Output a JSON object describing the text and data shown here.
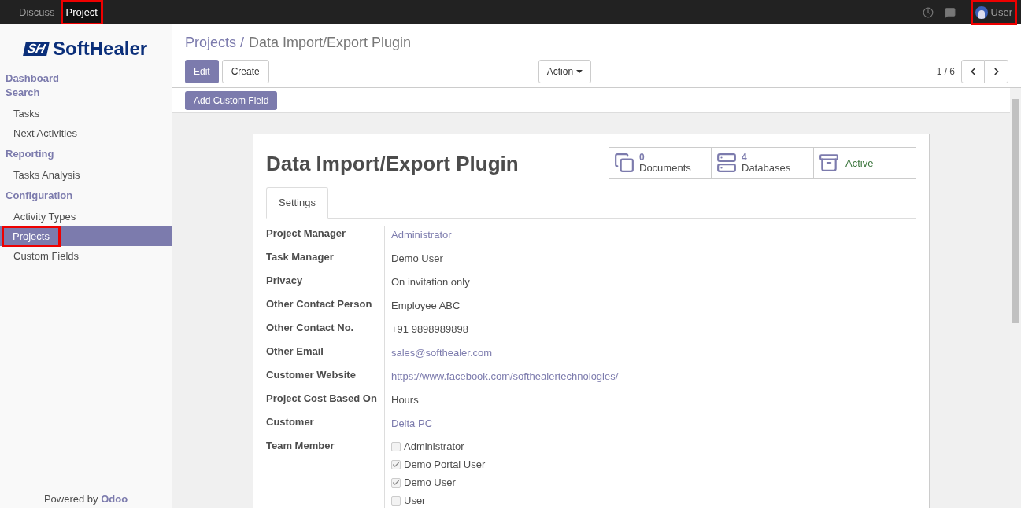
{
  "topbar": {
    "apps": [
      {
        "label": "Discuss",
        "selected": false,
        "highlighted": false
      },
      {
        "label": "Project",
        "selected": true,
        "highlighted": true
      }
    ],
    "user": {
      "label": "User",
      "highlighted": true
    }
  },
  "sidebar": {
    "logo": {
      "mark": "SH",
      "text": "SoftHealer"
    },
    "sections": [
      {
        "title": "Dashboard"
      },
      {
        "title": "Search",
        "items": [
          {
            "label": "Tasks",
            "selected": false,
            "highlighted": false
          },
          {
            "label": "Next Activities",
            "selected": false,
            "highlighted": false
          }
        ]
      },
      {
        "title": "Reporting",
        "items": [
          {
            "label": "Tasks Analysis",
            "selected": false,
            "highlighted": false
          }
        ]
      },
      {
        "title": "Configuration",
        "items": [
          {
            "label": "Activity Types",
            "selected": false,
            "highlighted": false
          },
          {
            "label": "Projects",
            "selected": true,
            "highlighted": true
          },
          {
            "label": "Custom Fields",
            "selected": false,
            "highlighted": false
          }
        ]
      }
    ],
    "footer": {
      "prefix": "Powered by",
      "brand": "Odoo"
    }
  },
  "control_panel": {
    "breadcrumb": {
      "parent": "Projects /",
      "current": "Data Import/Export Plugin"
    },
    "buttons": {
      "edit": "Edit",
      "create": "Create",
      "action": "Action"
    },
    "pager": "1 / 6"
  },
  "toolbar": {
    "button": "Add Custom Field"
  },
  "form": {
    "title": "Data Import/Export Plugin",
    "stat_buttons": [
      {
        "kind": "documents",
        "value": "0",
        "label": "Documents"
      },
      {
        "kind": "databases",
        "value": "4",
        "label": "Databases"
      },
      {
        "kind": "archive",
        "label": "Active"
      }
    ],
    "tabs": [
      {
        "label": "Settings",
        "selected": true
      }
    ],
    "fields": [
      {
        "label": "Project Manager",
        "kind": "link",
        "value": "Administrator"
      },
      {
        "label": "Task Manager",
        "kind": "text",
        "value": "Demo User"
      },
      {
        "label": "Privacy",
        "kind": "text",
        "value": "On invitation only"
      },
      {
        "label": "Other Contact Person",
        "kind": "text",
        "value": "Employee ABC"
      },
      {
        "label": "Other Contact No.",
        "kind": "text",
        "value": "+91 9898989898"
      },
      {
        "label": "Other Email",
        "kind": "link",
        "value": "sales@softhealer.com"
      },
      {
        "label": "Customer Website",
        "kind": "link",
        "value": "https://www.facebook.com/softhealertechnologies/"
      },
      {
        "label": "Project Cost Based On",
        "kind": "text",
        "value": "Hours"
      },
      {
        "label": "Customer",
        "kind": "link",
        "value": "Delta PC"
      },
      {
        "label": "Team Member",
        "kind": "checkboxes",
        "options": [
          {
            "label": "Administrator",
            "checked": false
          },
          {
            "label": "Demo Portal User",
            "checked": true
          },
          {
            "label": "Demo User",
            "checked": true
          },
          {
            "label": "User",
            "checked": false
          }
        ]
      }
    ]
  }
}
